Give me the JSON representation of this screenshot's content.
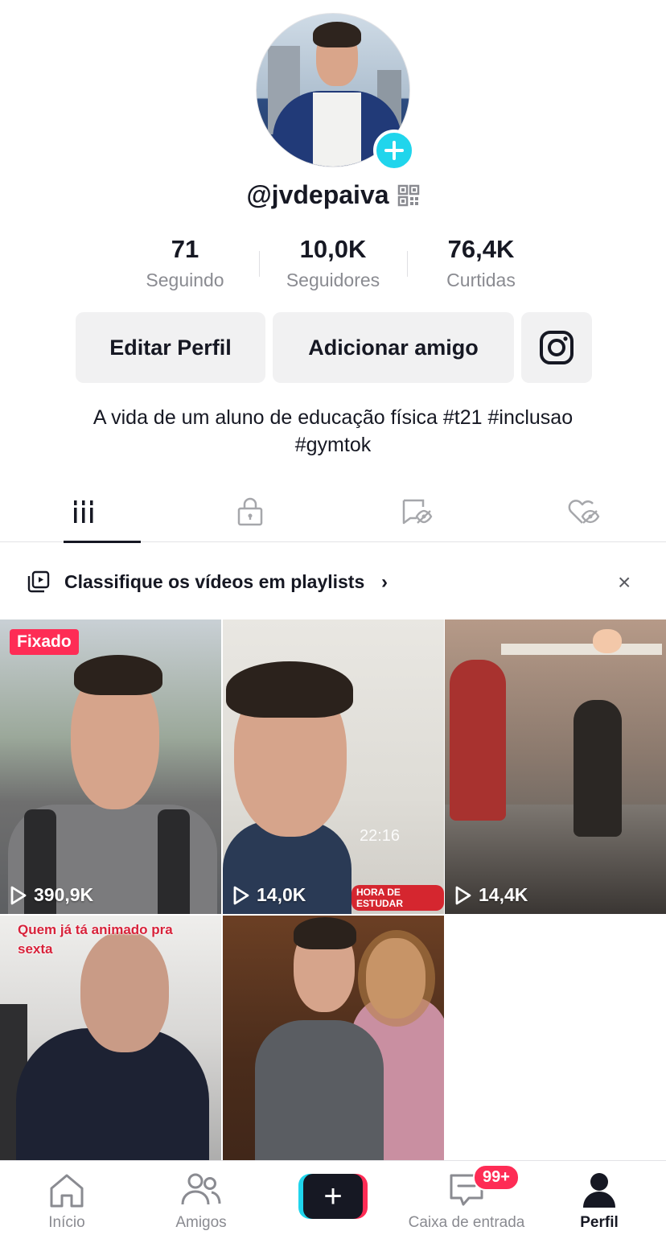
{
  "profile": {
    "handle": "@jvdepaiva",
    "stats": [
      {
        "value": "71",
        "label": "Seguindo"
      },
      {
        "value": "10,0K",
        "label": "Seguidores"
      },
      {
        "value": "76,4K",
        "label": "Curtidas"
      }
    ],
    "buttons": {
      "edit": "Editar Perfil",
      "add_friend": "Adicionar amigo",
      "instagram_icon": "instagram-icon"
    },
    "bio_line1": "A vida de um aluno de educação física #t21 #inclusao",
    "bio_line2": "#gymtok"
  },
  "tabs": [
    {
      "icon": "videos-grid-icon",
      "active": true
    },
    {
      "icon": "lock-icon",
      "active": false
    },
    {
      "icon": "reposts-hidden-icon",
      "active": false
    },
    {
      "icon": "liked-hidden-icon",
      "active": false
    }
  ],
  "playlist_banner": {
    "text": "Classifique os vídeos em playlists",
    "chevron": "›",
    "close": "×"
  },
  "videos": [
    {
      "views": "390,9K",
      "pinned_label": "Fixado"
    },
    {
      "views": "14,0K",
      "overlay_time": "22:16",
      "overlay_tag": "HORA DE ESTUDAR"
    },
    {
      "views": "14,4K"
    },
    {
      "caption_line1": "Quem já tá animado pra",
      "caption_line2": "sexta"
    },
    {}
  ],
  "nav": {
    "home": "Início",
    "friends": "Amigos",
    "create": "+",
    "inbox": "Caixa de entrada",
    "inbox_badge": "99+",
    "profile": "Perfil"
  },
  "colors": {
    "accent_pink": "#fe2c55",
    "accent_cyan": "#20d5ec",
    "text": "#161823",
    "muted": "#8a8b91"
  }
}
